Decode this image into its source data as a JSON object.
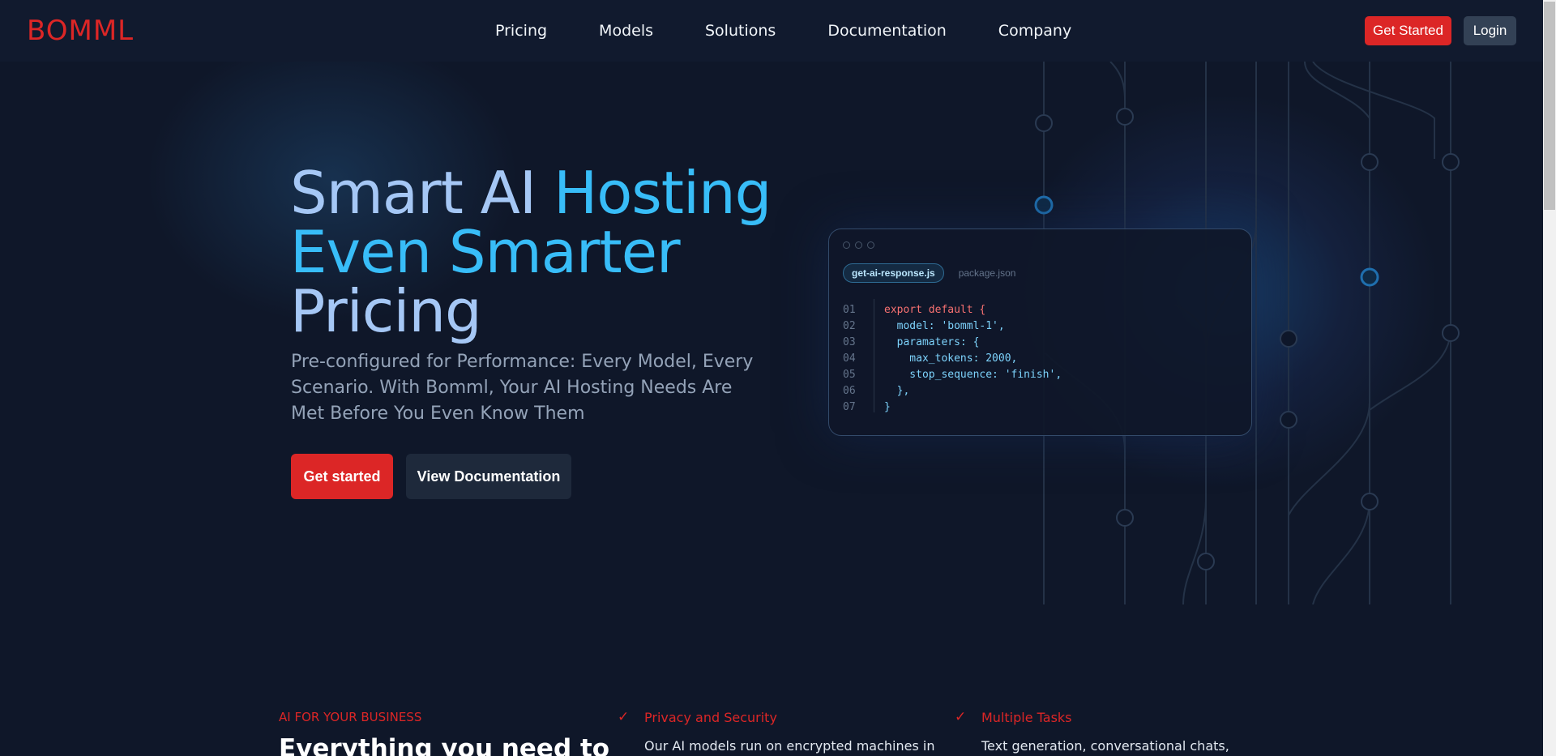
{
  "nav": {
    "logo": "BOMML",
    "links": [
      "Pricing",
      "Models",
      "Solutions",
      "Documentation",
      "Company"
    ],
    "get_started": "Get Started",
    "login": "Login"
  },
  "hero": {
    "title_line1a": "Smart AI ",
    "title_line1b": "Hosting",
    "title_line2": "Even Smarter",
    "title_line3": "Pricing",
    "subtitle": "Pre-configured for Performance: Every Model, Every Scenario. With Bomml, Your AI Hosting Needs Are Met Before You Even Know Them",
    "btn_start": "Get started",
    "btn_docs": "View Documentation"
  },
  "code_card": {
    "tab_active": "get-ai-response.js",
    "tab_inactive": "package.json",
    "lines": [
      {
        "n": "01",
        "code": "export default {"
      },
      {
        "n": "02",
        "code": "  model: 'bomml-1',"
      },
      {
        "n": "03",
        "code": "  paramaters: {"
      },
      {
        "n": "04",
        "code": "    max_tokens: 2000,"
      },
      {
        "n": "05",
        "code": "    stop_sequence: 'finish',"
      },
      {
        "n": "06",
        "code": "  },"
      },
      {
        "n": "07",
        "code": "}"
      }
    ]
  },
  "business": {
    "tag": "AI FOR YOUR BUSINESS",
    "heading": "Everything you need to",
    "features": [
      {
        "title": "Privacy and Security",
        "desc": "Our AI models run on encrypted machines in"
      },
      {
        "title": "Multiple Tasks",
        "desc": "Text generation, conversational chats,"
      }
    ]
  },
  "colors": {
    "accent": "#dc2626",
    "sky": "#38bdf8",
    "background": "#0f1729"
  }
}
